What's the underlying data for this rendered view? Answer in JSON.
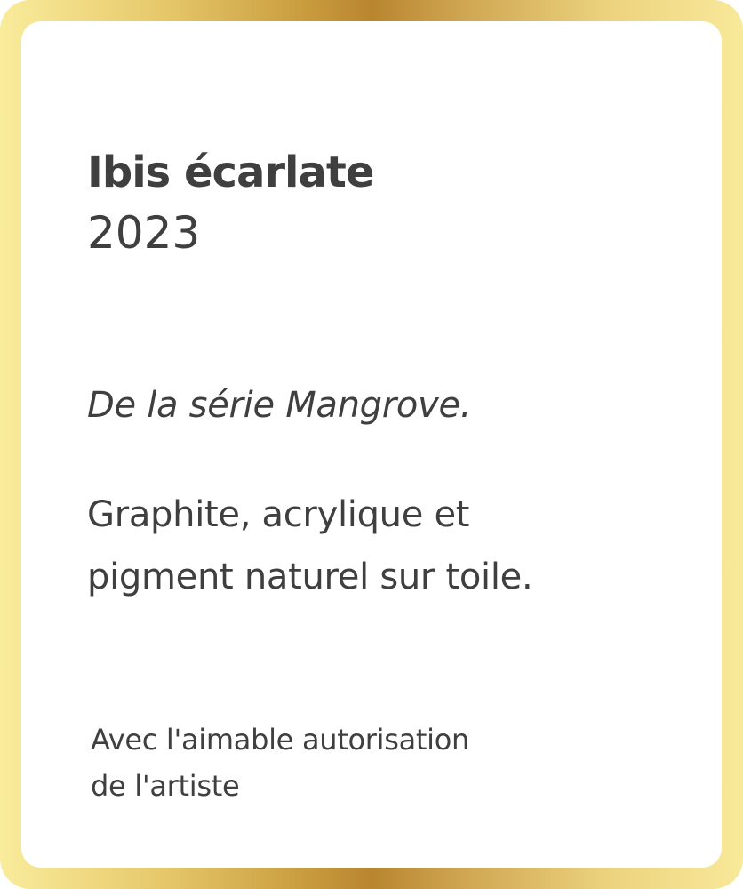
{
  "artwork": {
    "title": "Ibis écarlate",
    "year": "2023",
    "series_text": "De la série Mangrove.",
    "medium_lines": [
      "Graphite, acrylique et",
      "pigment naturel sur toile."
    ],
    "credit_lines": [
      "Avec l'aimable autorisation",
      "de l'artiste"
    ]
  },
  "colors": {
    "frame_gold_dark": "#b9852f",
    "frame_gold_light": "#f9ec9c",
    "card_background": "#ffffff",
    "text": "#3f3f3f"
  }
}
